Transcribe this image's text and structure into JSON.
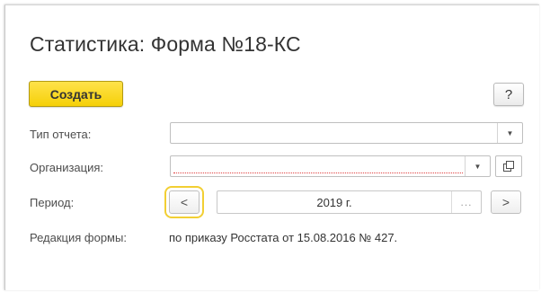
{
  "form": {
    "title": "Статистика: Форма №18-КС",
    "create_label": "Создать",
    "help_label": "?"
  },
  "fields": {
    "report_type": {
      "label": "Тип отчета:",
      "value": ""
    },
    "organization": {
      "label": "Организация:",
      "value": ""
    },
    "period": {
      "label": "Период:",
      "value": "2019 г.",
      "choose_label": "..."
    },
    "edition": {
      "label": "Редакция формы:",
      "value": "по приказу Росстата от 15.08.2016 № 427."
    }
  },
  "icons": {
    "dropdown": "chevron-down-icon",
    "open": "open-form-icon",
    "prev": "chevron-left-icon",
    "next": "chevron-right-icon"
  },
  "colors": {
    "create_button": "#f5d008",
    "focus_outline": "#f2cf33",
    "required_underline": "#e04040"
  }
}
